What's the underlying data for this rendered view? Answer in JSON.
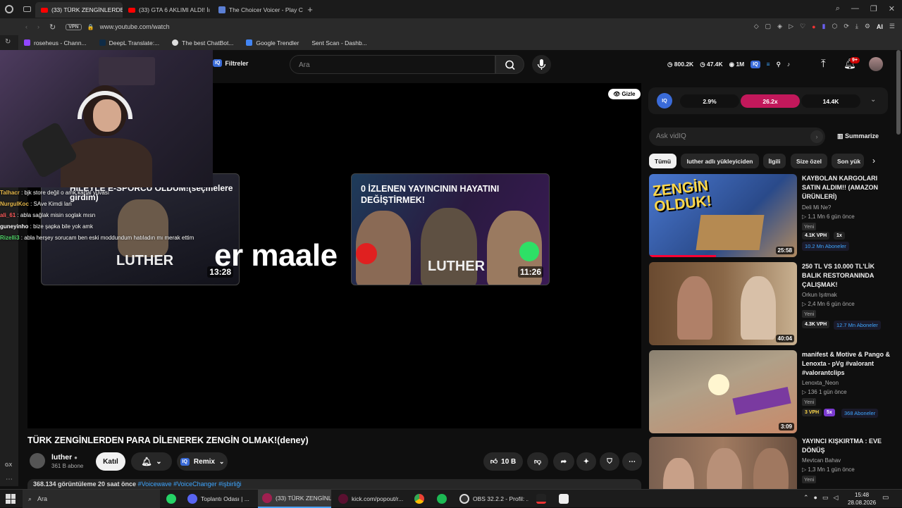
{
  "browser": {
    "tabs": [
      {
        "label": "(33) TÜRK ZENGİNLERDEN",
        "active": true
      },
      {
        "label": "(33) GTA 6 AKLIMI ALDI! İı",
        "active": false
      },
      {
        "label": "The Choicer Voicer - Play C",
        "active": false
      }
    ],
    "vpn": "VPN",
    "url": "www.youtube.com/watch",
    "ai_label": "AI",
    "bookmarks": [
      "roseheus - Chann...",
      "DeepL Translate:...",
      "The best ChatBot...",
      "Google Trendler",
      "Sent Scan - Dashb..."
    ]
  },
  "youtube": {
    "filters_label": "Filtreler",
    "iq_badge": "IQ",
    "search_placeholder": "Ara",
    "stats": {
      "views": "800.2K",
      "likes": "47.4K",
      "eye": "1M"
    },
    "notif_count": "9+"
  },
  "player": {
    "gizle_label": "Gizle",
    "big_text": "er maale",
    "thumb1": {
      "title": "HİLEYLE E-SPORCU OLDUM!(seçmelere girdim)",
      "overlay_text": "LUTHER",
      "duration": "13:28"
    },
    "thumb2": {
      "title": "0 İZLENEN YAYINCININ HAYATINI DEĞİŞTİRMEK!",
      "overlay_text": "LUTHER",
      "duration": "11:26"
    }
  },
  "chat": [
    {
      "user": "Talhacr",
      "msg": " : bjk store değil o amk kartal yuvası",
      "color": "#e6b84a"
    },
    {
      "user": "NurgulKoc",
      "msg": " : SAve Kimdi lan",
      "color": "#e6b84a"
    },
    {
      "user": "ali_61",
      "msg": " : abla sağlak misin soglak mısn",
      "color": "#ff5c5c"
    },
    {
      "user": "guneyinho",
      "msg": " : bize şapka bile yok amk",
      "color": "#ffffff"
    },
    {
      "user": "Rizelli3",
      "msg": " : abla herşey sorucam ben eski moddundum hatıladın mı merak ettim",
      "color": "#52d66a"
    }
  ],
  "video": {
    "title": "TÜRK ZENGİNLERDEN PARA DİLENEREK ZENGİN OLMAK!(deney)",
    "channel": "luther",
    "subs": "361 B abone",
    "join": "Katıl",
    "remix": "Remix",
    "likes": "10 B",
    "desc_stats": "368.134 görüntüleme  20 saat önce",
    "desc_tags": " #Voicewave #VoiceChanger #işbirliği"
  },
  "vidiq": {
    "pill1": "2.9%",
    "pill2": "26.2x",
    "pill3": "14.4K",
    "ask_placeholder": "Ask vidIQ",
    "summarize": "Summarize"
  },
  "chips": [
    "Tümü",
    "luther adlı yükleyiciden",
    "İlgili",
    "Size özel",
    "Son yük"
  ],
  "recs": [
    {
      "title": "KAYBOLAN KARGOLARI SATIN ALDIM!! (AMAZON ÜRÜNLERİ)",
      "channel": "Deli Mi Ne?",
      "meta": "▷ 1,1 Mn   6 gün önce",
      "new": "Yeni",
      "vph": "4.1K VPH",
      "mult": "1x",
      "subs": "10.2 Mn Aboneler",
      "duration": "25:58",
      "thumb_text": "ZENGİN OLDUK!"
    },
    {
      "title": "250 TL VS 10.000 TL'LİK BALIK RESTORANINDA ÇALIŞMAK!",
      "channel": "Orkun Işıtmak",
      "meta": "▷ 2,4 Mn   6 gün önce",
      "new": "Yeni",
      "vph": "4.3K VPH",
      "mult": "",
      "subs": "12.7 Mn Aboneler",
      "duration": "40:04",
      "thumb_text": ""
    },
    {
      "title": "manifest & Motive & Pango & Lenoxta - pVg #valorant #valorantclips",
      "channel": "Lenoxta_Neon",
      "meta": "▷ 136   1 gün önce",
      "new": "Yeni",
      "vph": "3 VPH",
      "mult": "5x",
      "subs": "368 Aboneler",
      "duration": "3:09",
      "thumb_text": ""
    },
    {
      "title": "YAYINCI KIŞKIRTMA : EVE DÖNÜŞ",
      "channel": "Mevtcan Bahav",
      "meta": "▷ 1,3 Mn   1 gün önce",
      "new": "Yeni",
      "vph": "",
      "mult": "",
      "subs": "",
      "duration": "",
      "thumb_text": ""
    }
  ],
  "taskbar": {
    "search": "Ara",
    "items": [
      "Toplantı Odası | ...",
      "(33) TÜRK ZENGİNL...",
      "kick.com/popout/r...",
      "OBS 32.2.2 - Profil: ..."
    ],
    "time": "15:48",
    "date": "28.08.2026",
    "gx": "GX"
  },
  "colors": {
    "accent_red": "#ff0033",
    "vidiq_pink": "#c2185b",
    "link_blue": "#3ea6ff"
  }
}
